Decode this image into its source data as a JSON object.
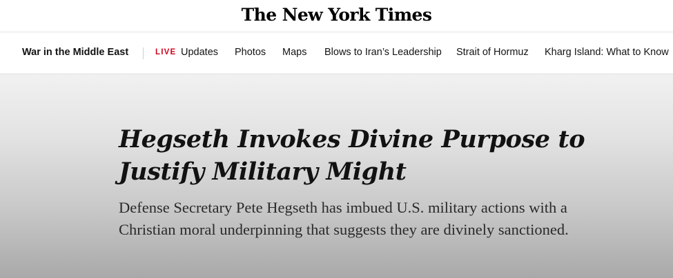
{
  "masthead": {
    "logo_text": "The New York Times"
  },
  "subnav": {
    "section_title": "War in the Middle East",
    "live_label": "LIVE",
    "links": [
      {
        "label": "Updates"
      },
      {
        "label": "Photos"
      },
      {
        "label": "Maps"
      },
      {
        "label": "Blows to Iran’s Leadership"
      },
      {
        "label": "Strait of Hormuz"
      },
      {
        "label": "Kharg Island: What to Know"
      }
    ]
  },
  "article": {
    "headline": "Hegseth Invokes Divine Purpose to Justify Military Might",
    "summary": "Defense Secretary Pete Hegseth has imbued U.S. military actions with a Christian moral underpinning that suggests they are divinely sanctioned."
  }
}
